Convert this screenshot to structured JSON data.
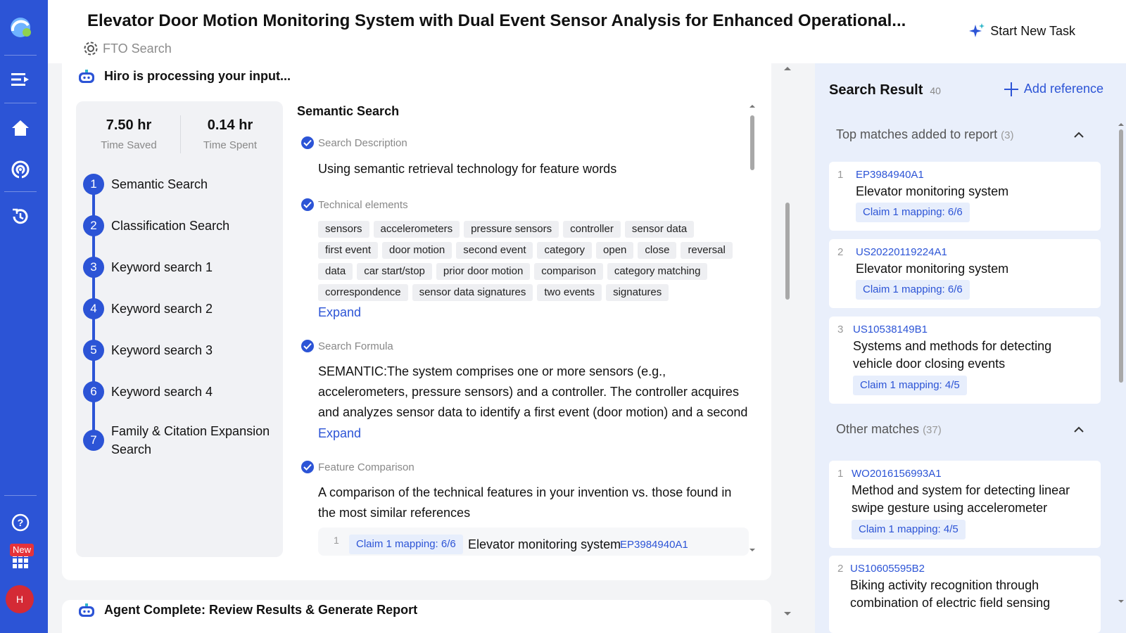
{
  "header": {
    "title": "Elevator Door Motion Monitoring System with Dual Event Sensor Analysis for Enhanced Operational...",
    "subtitle": "FTO Search",
    "new_task": "Start New Task"
  },
  "rail": {
    "new_badge": "New",
    "avatar_initial": "H"
  },
  "processing": {
    "heading": "Hiro is processing your input...",
    "time_saved_value": "7.50 hr",
    "time_saved_label": "Time Saved",
    "time_spent_value": "0.14 hr",
    "time_spent_label": "Time Spent",
    "steps": [
      {
        "num": "1",
        "label": "Semantic Search"
      },
      {
        "num": "2",
        "label": "Classification Search"
      },
      {
        "num": "3",
        "label": "Keyword search 1"
      },
      {
        "num": "4",
        "label": "Keyword search 2"
      },
      {
        "num": "5",
        "label": "Keyword search 3"
      },
      {
        "num": "6",
        "label": "Keyword search 4"
      },
      {
        "num": "7",
        "label": "Family & Citation Expansion Search"
      }
    ]
  },
  "detail": {
    "title": "Semantic Search",
    "search_description_label": "Search Description",
    "search_description": "Using semantic retrieval technology for feature words",
    "tech_elements_label": "Technical elements",
    "tags": [
      "sensors",
      "accelerometers",
      "pressure sensors",
      "controller",
      "sensor data",
      "first event",
      "door motion",
      "second event",
      "category",
      "open",
      "close",
      "reversal",
      "data",
      "car start/stop",
      "prior door motion",
      "comparison",
      "category matching",
      "correspondence",
      "sensor data signatures",
      "two events",
      "signatures"
    ],
    "expand_label": "Expand",
    "formula_label": "Search Formula",
    "formula_text": "SEMANTIC:The system comprises one or more sensors (e.g., accelerometers, pressure sensors) and a controller. The controller acquires and analyzes sensor data to identify a first event (door motion) and a second event. The first event'...",
    "feature_label": "Feature Comparison",
    "feature_text": "A comparison of the technical features in your invention vs. those found in the most similar references",
    "feature_row": {
      "idx": "1",
      "mapping": "Claim 1 mapping: 6/6",
      "title": "Elevator monitoring system",
      "id": "EP3984940A1"
    }
  },
  "agent_complete": "Agent Complete: Review Results & Generate Report",
  "results": {
    "title": "Search Result",
    "count": "40",
    "add_reference": "Add reference",
    "top_label": "Top matches added to report",
    "top_count": "(3)",
    "top": [
      {
        "idx": "1",
        "id": "EP3984940A1",
        "title": "Elevator monitoring system",
        "mapping": "Claim 1 mapping: 6/6"
      },
      {
        "idx": "2",
        "id": "US20220119224A1",
        "title": "Elevator monitoring system",
        "mapping": "Claim 1 mapping: 6/6"
      },
      {
        "idx": "3",
        "id": "US10538149B1",
        "title": "Systems and methods for detecting vehicle door closing events",
        "mapping": "Claim 1 mapping: 4/5"
      }
    ],
    "other_label": "Other matches",
    "other_count": "(37)",
    "other": [
      {
        "idx": "1",
        "id": "WO2016156993A1",
        "title": "Method and system for detecting linear swipe gesture using accelerometer",
        "mapping": "Claim 1 mapping: 4/5"
      },
      {
        "idx": "2",
        "id": "US10605595B2",
        "title": "Biking activity recognition through combination of electric field sensing and..."
      }
    ]
  },
  "colors": {
    "accent": "#2c54d6",
    "rail": "#2c54d6",
    "panel": "#e9effb"
  }
}
